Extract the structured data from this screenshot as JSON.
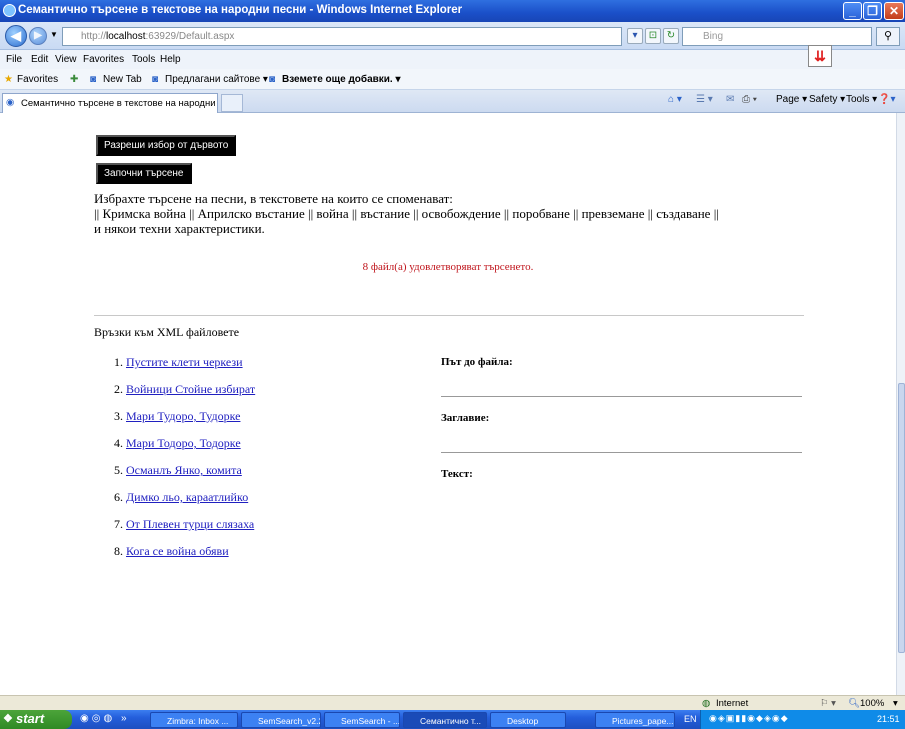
{
  "window": {
    "title": "Семантично търсене в текстове на народни песни - Windows Internet Explorer"
  },
  "address": {
    "prefix": "http://",
    "host": "localhost",
    "rest": ":63929/Default.aspx"
  },
  "search": {
    "placeholder": "Bing"
  },
  "menu": [
    "File",
    "Edit",
    "View",
    "Favorites",
    "Tools",
    "Help"
  ],
  "favorites": {
    "label": "Favorites",
    "items": [
      "New Tab",
      "Предлагани сайтове ▾",
      "Вземете още добавки. ▾"
    ]
  },
  "tab": {
    "label": "Семантично търсене в текстове на народни песни"
  },
  "command_bar": [
    "Page ▾",
    "Safety ▾",
    "Tools ▾"
  ],
  "page": {
    "btn_tree": "Разреши избор от дървото",
    "btn_search": "Започни търсене",
    "intro_line1": "Избрахте търсене на песни, в текстовете на които се споменават:",
    "intro_line2": "|| Кримска война || Априлско въстание || война || въстание || освобождение || поробване || превземане || създаване ||",
    "intro_line3": "и някои техни характеристики.",
    "result": "8 файл(а) удовлетворяват търсенето.",
    "links_heading": "Връзки към XML файловете",
    "links": [
      {
        "num": "1.",
        "text": "Пустите клети черкези"
      },
      {
        "num": "2.",
        "text": "Войници Стойне избират"
      },
      {
        "num": "3.",
        "text": "Мари Тудоро, Тудорке"
      },
      {
        "num": "4.",
        "text": "Мари Тодоро, Тодорке"
      },
      {
        "num": "5.",
        "text": "Османлъ Янко, комита"
      },
      {
        "num": "6.",
        "text": "Димко льо, караатлийко"
      },
      {
        "num": "7.",
        "text": "От Плевен турци слязаха"
      },
      {
        "num": "8.",
        "text": "Кога се война обяви"
      }
    ],
    "path_label": "Път до файла:",
    "title_label": "Заглавие:",
    "text_label": "Текст:"
  },
  "status": {
    "zone": "Internet",
    "zoom": "100%"
  },
  "taskbar": {
    "start": "start",
    "tasks": [
      "Zimbra: Inbox ...",
      "SemSearch_v2.2",
      "SemSearch - ...",
      "Семантично т...",
      "Desktop",
      "Pictures_pape..."
    ],
    "lang": "EN",
    "clock": "21:51"
  }
}
